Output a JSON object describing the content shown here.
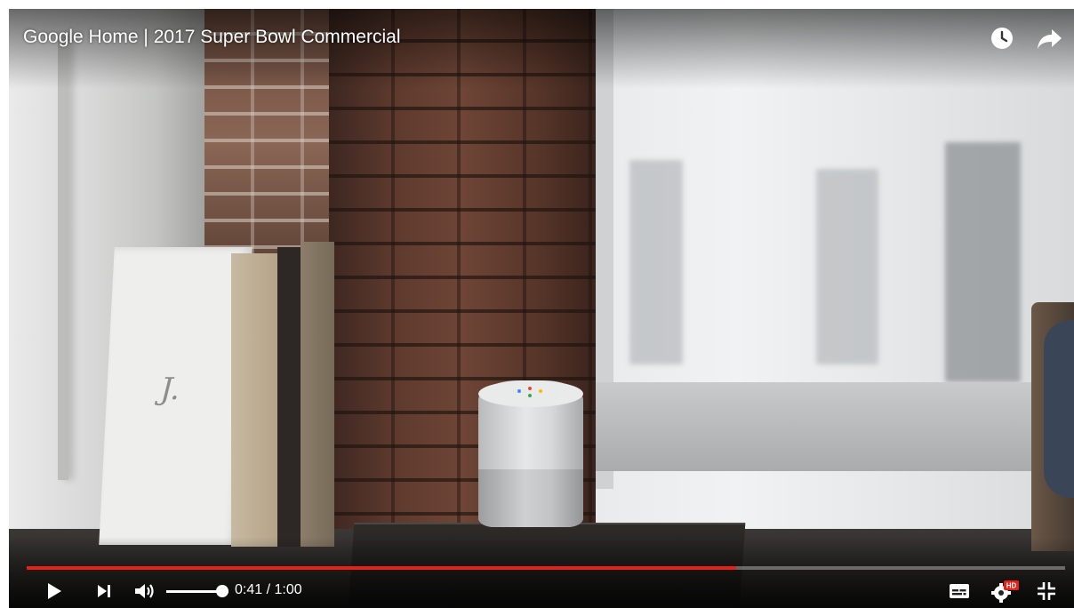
{
  "video": {
    "title": "Google Home | 2017 Super Bowl Commercial"
  },
  "top_actions": [
    {
      "icon": "watch-later-icon"
    },
    {
      "icon": "share-icon"
    }
  ],
  "progress": {
    "played_fraction": 0.683,
    "buffered_fraction": 0.683,
    "played_color": "#e62117"
  },
  "controls": {
    "play_icon": "play-icon",
    "next_icon": "next-icon",
    "volume_icon": "volume-icon",
    "volume_level": 1.0,
    "current_time": "0:41",
    "separator": "/",
    "duration": "1:00",
    "subtitles_icon": "subtitles-icon",
    "settings_icon": "settings-icon",
    "settings_badge": "HD",
    "exit_fullscreen_icon": "exit-fullscreen-icon"
  },
  "scene": {
    "book_mark": "J."
  }
}
